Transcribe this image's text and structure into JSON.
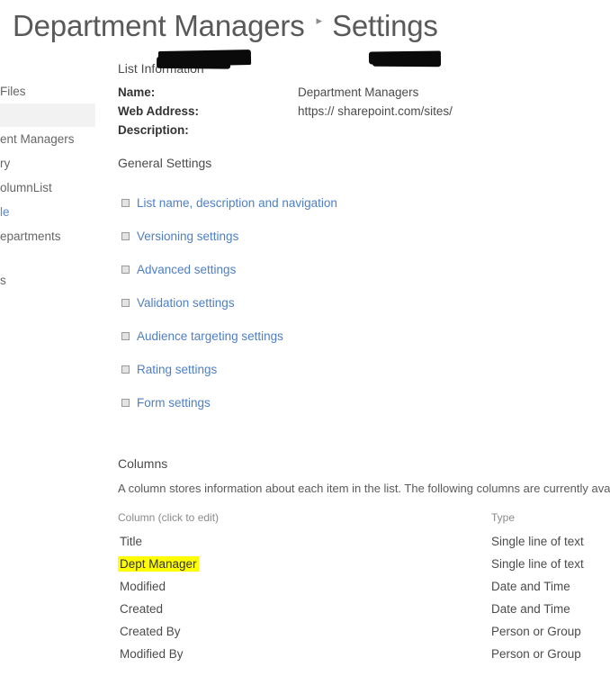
{
  "header": {
    "breadcrumb": [
      "Department Managers",
      "Settings"
    ],
    "separator": "▸"
  },
  "left_nav": {
    "items": [
      {
        "label": "Files",
        "clipped": true,
        "style": "text"
      },
      {
        "label": "",
        "style": "band"
      },
      {
        "label": "ent Managers",
        "clipped": true,
        "style": "text"
      },
      {
        "label": "ry",
        "clipped": true,
        "style": "text"
      },
      {
        "label": "olumnList",
        "clipped": true,
        "style": "text"
      },
      {
        "label": "le",
        "clipped": true,
        "style": "text"
      },
      {
        "label": "epartments",
        "clipped": true,
        "style": "text"
      },
      {
        "label": "s",
        "clipped": true,
        "style": "text"
      }
    ]
  },
  "list_information": {
    "title": "List Information",
    "rows": [
      {
        "label": "Name:",
        "value": "Department Managers"
      },
      {
        "label": "Web Address:",
        "value": "https://                        sharepoint.com/sites/"
      },
      {
        "label": "Description:",
        "value": ""
      }
    ]
  },
  "general_settings": {
    "title": "General Settings",
    "links": [
      "List name, description and navigation",
      "Versioning settings",
      "Advanced settings",
      "Validation settings",
      "Audience targeting settings",
      "Rating settings",
      "Form settings"
    ]
  },
  "columns_section": {
    "title": "Columns",
    "description": "A column stores information about each item in the list. The following columns are currently available in t",
    "headers": {
      "name": "Column (click to edit)",
      "type": "Type"
    },
    "rows": [
      {
        "name": "Title",
        "type": "Single line of text",
        "highlighted": false
      },
      {
        "name": "Dept Manager",
        "type": "Single line of text",
        "highlighted": true
      },
      {
        "name": "Modified",
        "type": "Date and Time",
        "highlighted": false
      },
      {
        "name": "Created",
        "type": "Date and Time",
        "highlighted": false
      },
      {
        "name": "Created By",
        "type": "Person or Group",
        "highlighted": false
      },
      {
        "name": "Modified By",
        "type": "Person or Group",
        "highlighted": false
      }
    ]
  },
  "colors": {
    "link_blue": "#4e7fc4",
    "highlight_yellow": "#ffff00",
    "nav_band_gray": "#f2f2f2",
    "redaction_black": "#0a0a0a",
    "header_gray": "#595959"
  }
}
